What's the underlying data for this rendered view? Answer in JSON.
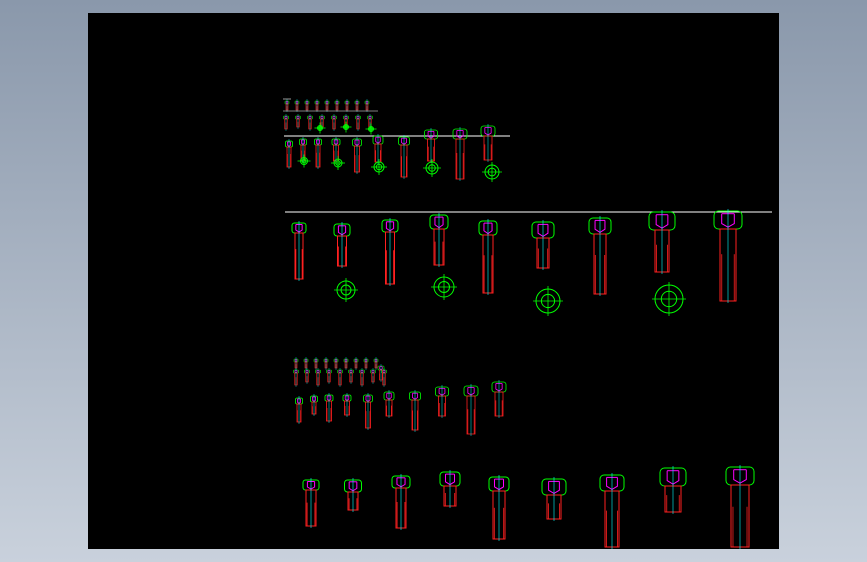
{
  "window": {
    "background_top": "#8a98ab",
    "background_bottom": "#c9d1dc"
  },
  "viewport": {
    "background": "#000000"
  },
  "drawing": {
    "line_colors": {
      "body": "#ff2020",
      "head": "#00ff00",
      "socket": "#ff00ff",
      "axis": "#00ffff",
      "rule": "#ffffff",
      "crosshair": "#ffff00"
    },
    "groups": [
      {
        "name": "large-set-top",
        "bolt_count": 9,
        "plan_view_count": 4
      },
      {
        "name": "small-set-top",
        "bolt_count": 8,
        "plan_view_count": 5
      },
      {
        "name": "small-set-bottom",
        "bolt_count": 8
      },
      {
        "name": "large-set-bottom",
        "bolt_count": 9
      }
    ]
  }
}
